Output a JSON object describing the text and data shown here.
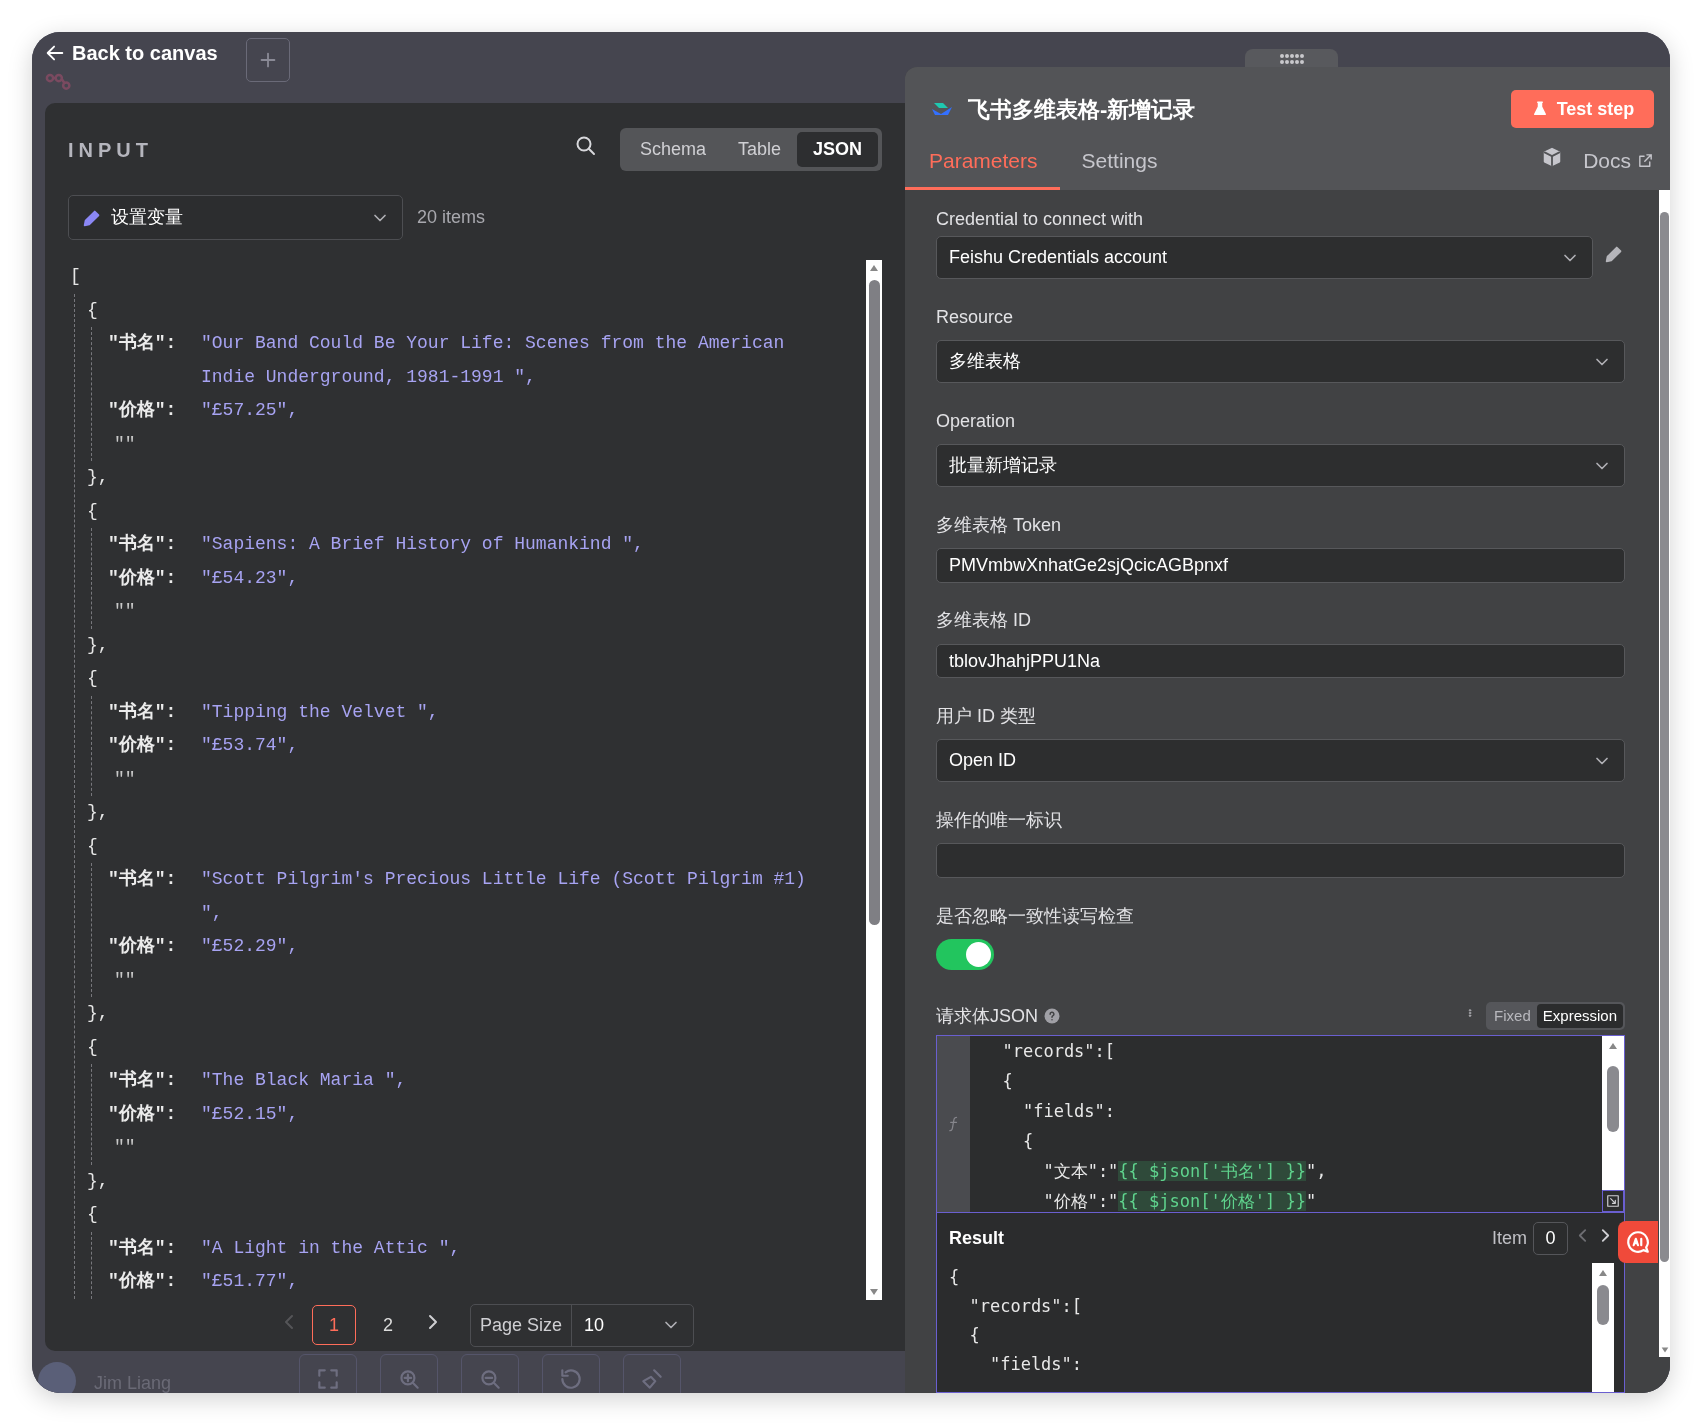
{
  "header": {
    "back_label": "Back to canvas"
  },
  "canvas": {
    "user_name": "Jim Liang"
  },
  "input_panel": {
    "title": "INPUT",
    "view_modes": [
      {
        "label": "Schema",
        "selected": false
      },
      {
        "label": "Table",
        "selected": false
      },
      {
        "label": "JSON",
        "selected": true
      }
    ],
    "source_node": "设置变量",
    "item_count": "20 items",
    "json_view": {
      "open": "[",
      "items": [
        {
          "open": "{",
          "pairs": [
            {
              "key": "\"书名\":",
              "value": "\"Our Band Could Be Your Life: Scenes from the American Indie Underground, 1981-1991 \","
            },
            {
              "key": "\"价格\":",
              "value": "\"£57.25\","
            }
          ],
          "extra": "\"\"",
          "close": "},"
        },
        {
          "open": "{",
          "pairs": [
            {
              "key": "\"书名\":",
              "value": "\"Sapiens: A Brief History of Humankind \","
            },
            {
              "key": "\"价格\":",
              "value": "\"£54.23\","
            }
          ],
          "extra": "\"\"",
          "close": "},"
        },
        {
          "open": "{",
          "pairs": [
            {
              "key": "\"书名\":",
              "value": "\"Tipping the Velvet \","
            },
            {
              "key": "\"价格\":",
              "value": "\"£53.74\","
            }
          ],
          "extra": "\"\"",
          "close": "},"
        },
        {
          "open": "{",
          "pairs": [
            {
              "key": "\"书名\":",
              "value": "\"Scott Pilgrim's Precious Little Life (Scott Pilgrim #1) \","
            },
            {
              "key": "\"价格\":",
              "value": "\"£52.29\","
            }
          ],
          "extra": "\"\"",
          "close": "},"
        },
        {
          "open": "{",
          "pairs": [
            {
              "key": "\"书名\":",
              "value": "\"The Black Maria \","
            },
            {
              "key": "\"价格\":",
              "value": "\"£52.15\","
            }
          ],
          "extra": "\"\"",
          "close": "},"
        },
        {
          "open": "{",
          "pairs": [
            {
              "key": "\"书名\":",
              "value": "\"A Light in the Attic \","
            },
            {
              "key": "\"价格\":",
              "value": "\"£51.77\","
            }
          ]
        }
      ]
    },
    "pagination": {
      "pages": [
        {
          "label": "1",
          "selected": true
        },
        {
          "label": "2",
          "selected": false
        }
      ],
      "page_size_label": "Page Size",
      "page_size": "10"
    }
  },
  "node_panel": {
    "title": "飞书多维表格-新增记录",
    "test_button": "Test step",
    "tabs": [
      {
        "label": "Parameters",
        "selected": true
      },
      {
        "label": "Settings",
        "selected": false
      }
    ],
    "docs_label": "Docs",
    "fields": [
      {
        "kind": "credential",
        "label": "Credential to connect with",
        "value": "Feishu Credentials account"
      },
      {
        "kind": "select",
        "label": "Resource",
        "value": "多维表格"
      },
      {
        "kind": "select",
        "label": "Operation",
        "value": "批量新增记录"
      },
      {
        "kind": "input",
        "label": "多维表格 Token",
        "value": "PMVmbwXnhatGe2sjQcicAGBpnxf"
      },
      {
        "kind": "input",
        "label": "多维表格 ID",
        "value": "tblovJhahjPPU1Na"
      },
      {
        "kind": "select",
        "label": "用户 ID 类型",
        "value": "Open ID"
      },
      {
        "kind": "input",
        "label": "操作的唯一标识"
      },
      {
        "kind": "toggle",
        "label": "是否忽略一致性读写检查",
        "on": true
      },
      {
        "kind": "code",
        "label": "请求体JSON",
        "modes": [
          {
            "label": "Fixed",
            "selected": false
          },
          {
            "label": "Expression",
            "selected": true
          }
        ],
        "lines": [
          {
            "parts": [
              {
                "kind": "plain",
                "text": "  \"records\":["
              }
            ]
          },
          {
            "parts": [
              {
                "kind": "plain",
                "text": "  {"
              }
            ]
          },
          {
            "parts": [
              {
                "kind": "plain",
                "text": "    \"fields\":"
              }
            ]
          },
          {
            "parts": [
              {
                "kind": "plain",
                "text": "    {"
              }
            ]
          },
          {
            "parts": [
              {
                "kind": "plain",
                "text": "      \"文本\":\""
              },
              {
                "kind": "expression",
                "text": "{{ $json['书名'] }}"
              },
              {
                "kind": "plain",
                "text": "\","
              }
            ]
          },
          {
            "parts": [
              {
                "kind": "plain",
                "text": "      \"价格\":\""
              },
              {
                "kind": "expression",
                "text": "{{ $json['价格'] }}"
              },
              {
                "kind": "plain",
                "text": "\""
              }
            ]
          }
        ],
        "result": {
          "label": "Result",
          "item_label": "Item",
          "item_index": "0",
          "lines": [
            "{",
            "  \"records\":[",
            "  {",
            "    \"fields\":"
          ]
        }
      }
    ]
  }
}
